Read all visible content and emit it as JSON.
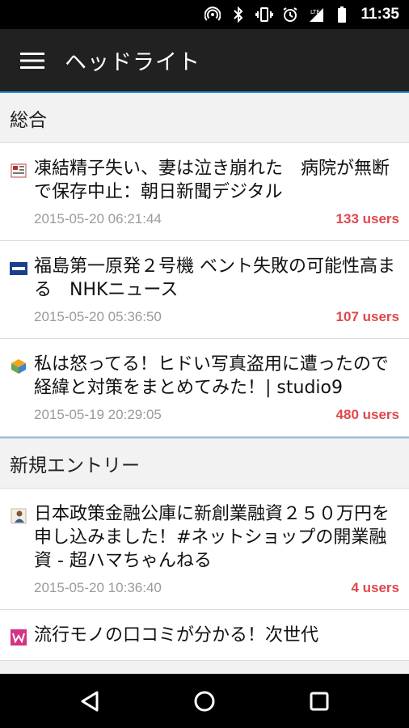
{
  "status_bar": {
    "time": "11:35",
    "icons": [
      "hotspot-icon",
      "bluetooth-icon",
      "vibrate-icon",
      "alarm-icon",
      "signal-icon",
      "battery-icon"
    ]
  },
  "app_bar": {
    "title": "ヘッドライト",
    "menu_icon": "hamburger-menu-icon"
  },
  "sections": [
    {
      "title": "総合",
      "entries": [
        {
          "title": "凍結精子失い、妻は泣き崩れた　病院が無断で保存中止：朝日新聞デジタル",
          "date": "2015-05-20 06:21:44",
          "users": "133 users",
          "favicon": "asahi-favicon"
        },
        {
          "title": "福島第一原発２号機 ベント失敗の可能性高まる　NHKニュース",
          "date": "2015-05-20 05:36:50",
          "users": "107 users",
          "favicon": "nhk-favicon"
        },
        {
          "title": "私は怒ってる！ヒドい写真盗用に遭ったので経緯と対策をまとめてみた！| studio9",
          "date": "2015-05-19 20:29:05",
          "users": "480 users",
          "favicon": "studio9-favicon"
        }
      ]
    },
    {
      "title": "新規エントリー",
      "entries": [
        {
          "title": "日本政策金融公庫に新創業融資２５０万円を申し込みました！#ネットショップの開業融資 - 超ハマちゃんねる",
          "date": "2015-05-20 10:36:40",
          "users": "4 users",
          "favicon": "person-favicon"
        },
        {
          "title": "流行モノの口コミが分かる！次世代",
          "date": "",
          "users": "",
          "favicon": "w-favicon"
        }
      ]
    }
  ],
  "nav_bar": {
    "back": "back-icon",
    "home": "home-icon",
    "recents": "recents-icon"
  },
  "colors": {
    "app_bar": "#212121",
    "accent": "#2b8fd6",
    "users": "#e0474c",
    "date": "#9a9a9a"
  }
}
